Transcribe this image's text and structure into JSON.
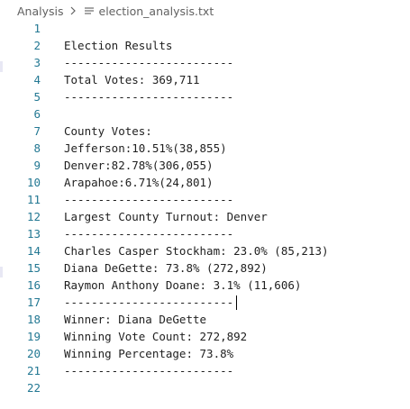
{
  "breadcrumb": {
    "folder": "Analysis",
    "separator_icon": "chevron-right-icon",
    "file_icon": "text-file-icon",
    "file": "election_analysis.txt"
  },
  "lines": [
    {
      "num": "1",
      "text": ""
    },
    {
      "num": "2",
      "text": "Election Results"
    },
    {
      "num": "3",
      "text": "-------------------------"
    },
    {
      "num": "4",
      "text": "Total Votes: 369,711"
    },
    {
      "num": "5",
      "text": "-------------------------"
    },
    {
      "num": "6",
      "text": ""
    },
    {
      "num": "7",
      "text": "County Votes:"
    },
    {
      "num": "8",
      "text": "Jefferson:10.51%(38,855)"
    },
    {
      "num": "9",
      "text": "Denver:82.78%(306,055)"
    },
    {
      "num": "10",
      "text": "Arapahoe:6.71%(24,801)"
    },
    {
      "num": "11",
      "text": "-------------------------"
    },
    {
      "num": "12",
      "text": "Largest County Turnout: Denver"
    },
    {
      "num": "13",
      "text": "-------------------------"
    },
    {
      "num": "14",
      "text": "Charles Casper Stockham: 23.0% (85,213)"
    },
    {
      "num": "15",
      "text": "Diana DeGette: 73.8% (272,892)"
    },
    {
      "num": "16",
      "text": "Raymon Anthony Doane: 3.1% (11,606)"
    },
    {
      "num": "17",
      "text": "-------------------------"
    },
    {
      "num": "18",
      "text": "Winner: Diana DeGette"
    },
    {
      "num": "19",
      "text": "Winning Vote Count: 272,892"
    },
    {
      "num": "20",
      "text": "Winning Percentage: 73.8%"
    },
    {
      "num": "21",
      "text": "-------------------------"
    },
    {
      "num": "22",
      "text": ""
    }
  ],
  "colors": {
    "line_number": "#237893",
    "text": "#1f1f1f",
    "breadcrumb": "#616161",
    "background": "#ffffff"
  }
}
